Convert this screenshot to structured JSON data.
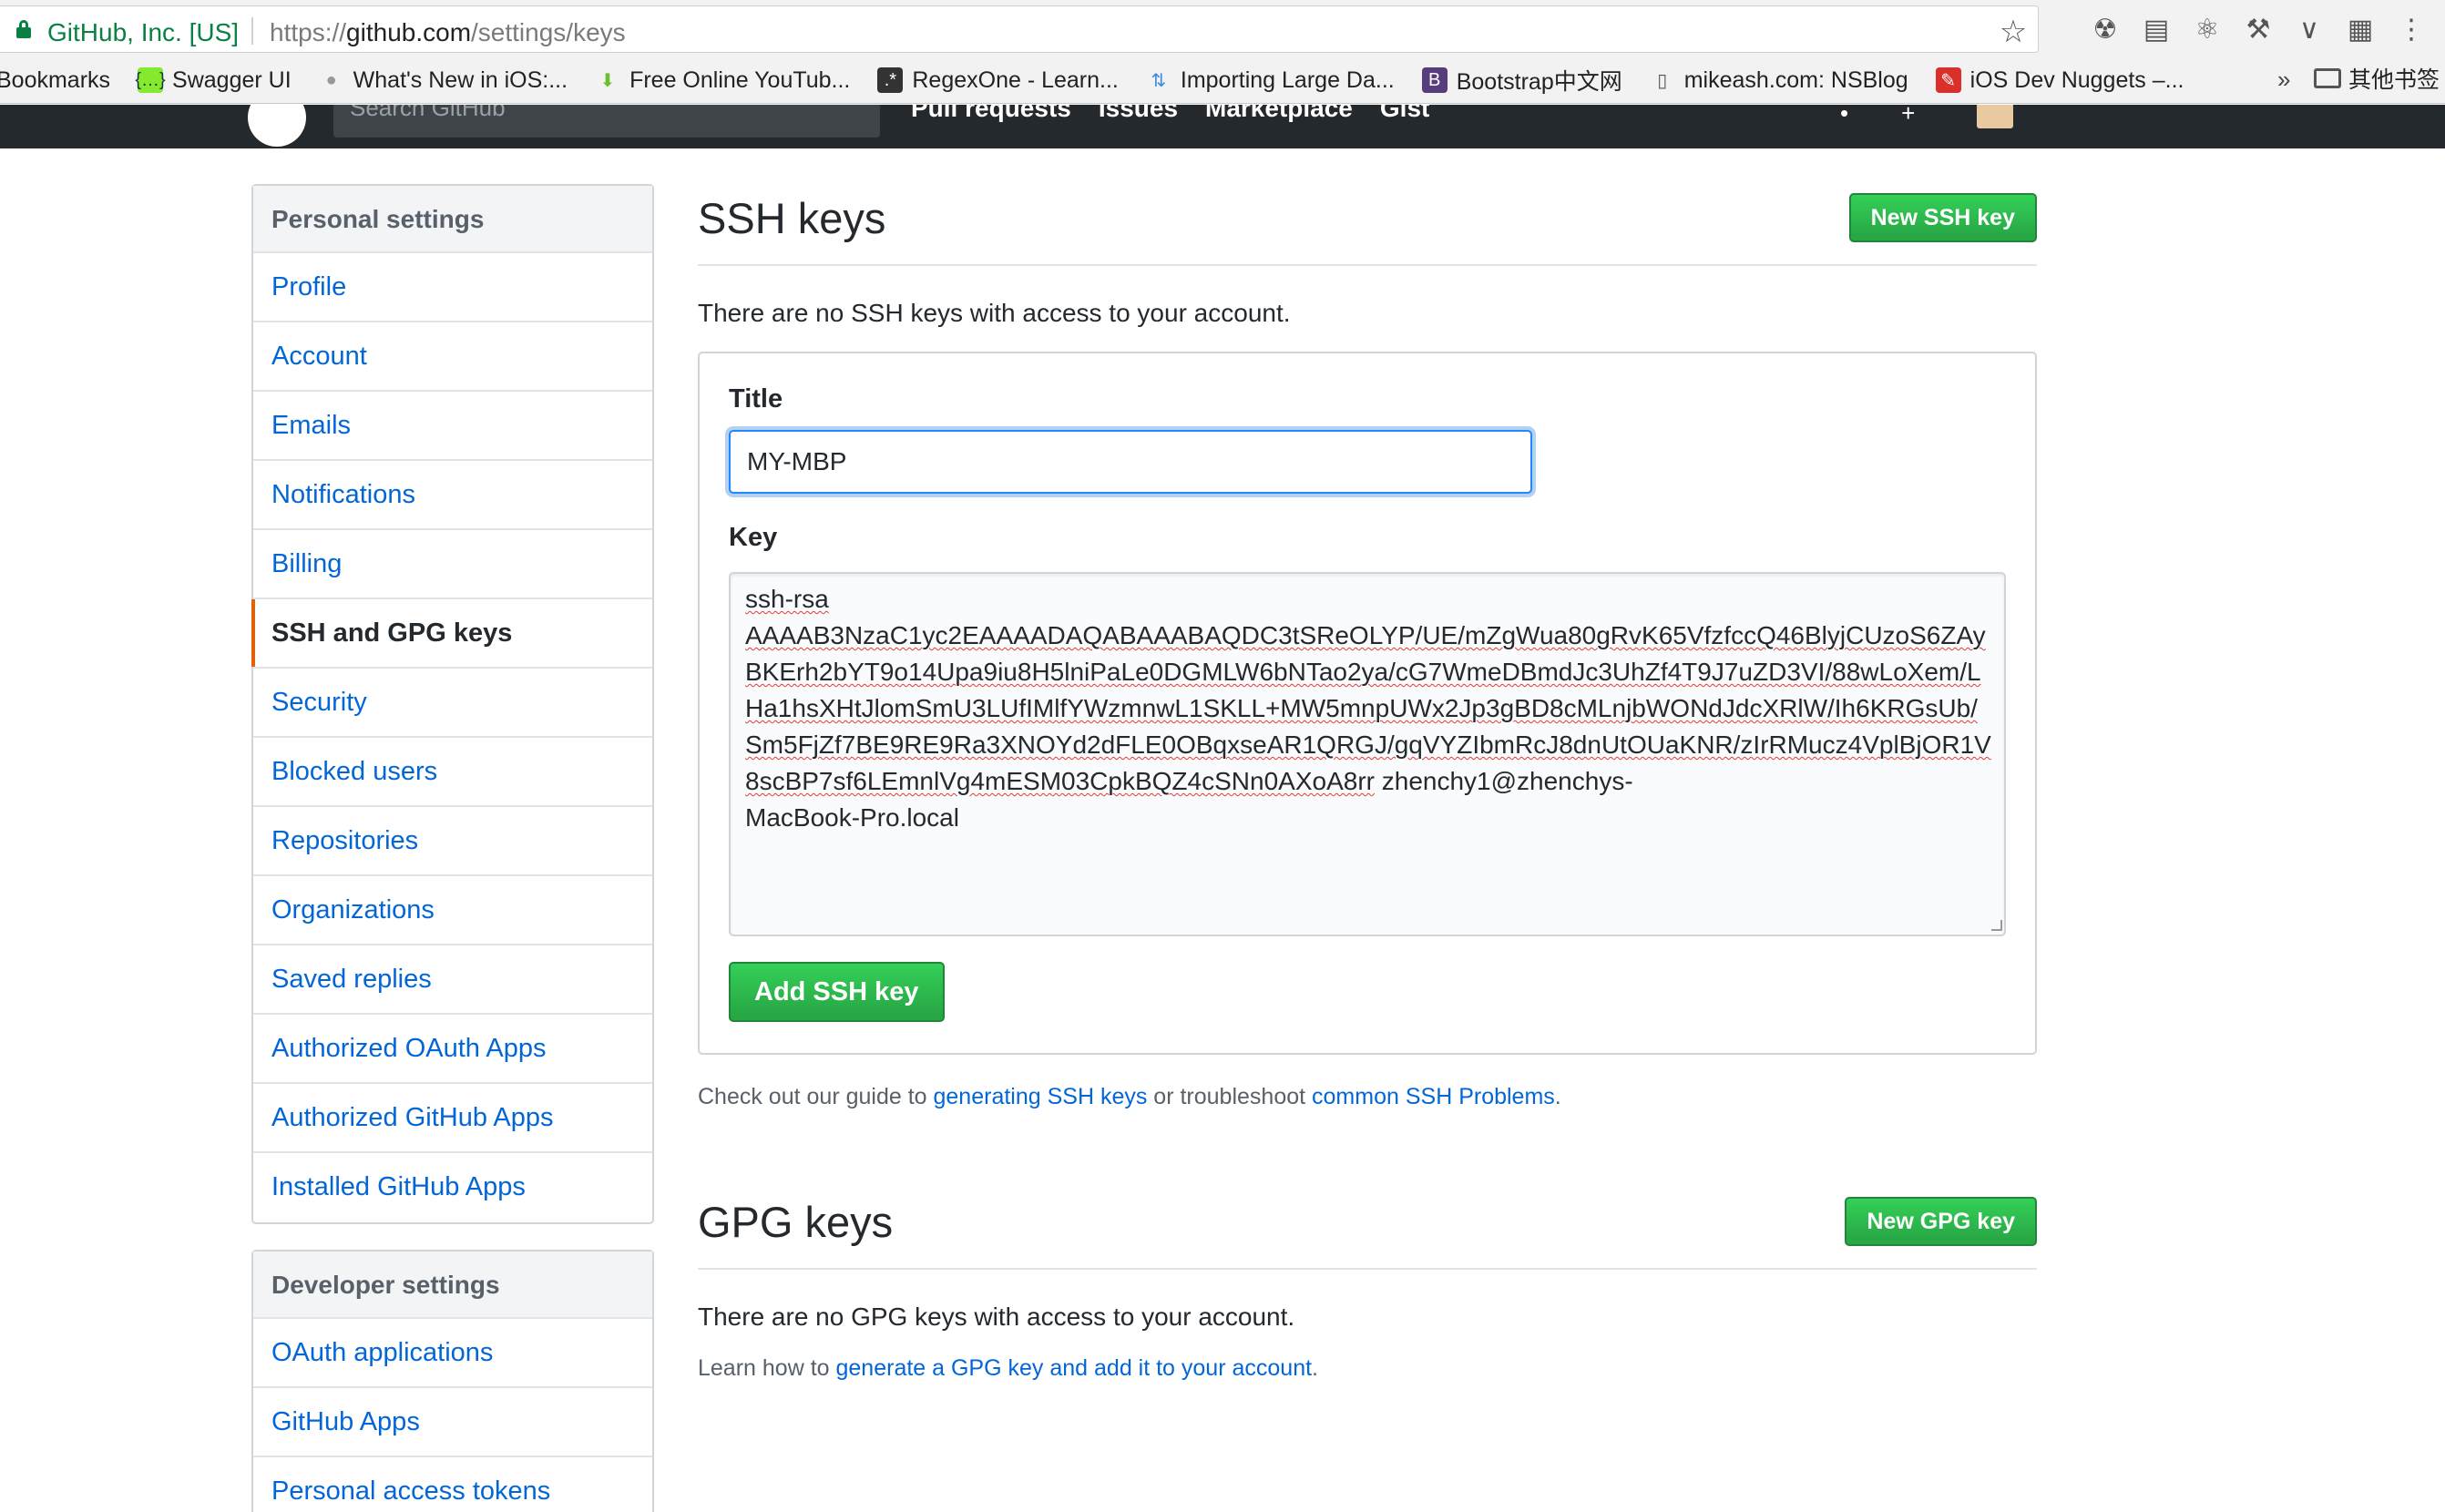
{
  "browser": {
    "site_identity": "GitHub, Inc. [US]",
    "url_protocol": "https://",
    "url_host": "github.com",
    "url_path": "/settings/keys",
    "bookmarks": [
      {
        "label": "Bookmarks",
        "icon": "none"
      },
      {
        "label": "Swagger UI",
        "icon": "swagger-icon"
      },
      {
        "label": "What's New in iOS:...",
        "icon": "apple-icon"
      },
      {
        "label": "Free Online YouTub...",
        "icon": "download-arrow-icon"
      },
      {
        "label": "RegexOne - Learn...",
        "icon": "regex-icon"
      },
      {
        "label": "Importing Large Da...",
        "icon": "sort-arrows-icon"
      },
      {
        "label": "Bootstrap中文网",
        "icon": "bootstrap-icon"
      },
      {
        "label": "mikeash.com: NSBlog",
        "icon": "page-icon"
      },
      {
        "label": "iOS Dev Nuggets –...",
        "icon": "nuggets-icon"
      }
    ],
    "bookmarks_overflow": "»",
    "other_bookmarks": "其他书签"
  },
  "github_header": {
    "search_placeholder": "Search GitHub",
    "nav": [
      "Pull requests",
      "Issues",
      "Marketplace",
      "Gist"
    ]
  },
  "sidebar": {
    "personal_heading": "Personal settings",
    "personal_items": [
      {
        "label": "Profile",
        "selected": false
      },
      {
        "label": "Account",
        "selected": false
      },
      {
        "label": "Emails",
        "selected": false
      },
      {
        "label": "Notifications",
        "selected": false
      },
      {
        "label": "Billing",
        "selected": false
      },
      {
        "label": "SSH and GPG keys",
        "selected": true
      },
      {
        "label": "Security",
        "selected": false
      },
      {
        "label": "Blocked users",
        "selected": false
      },
      {
        "label": "Repositories",
        "selected": false
      },
      {
        "label": "Organizations",
        "selected": false
      },
      {
        "label": "Saved replies",
        "selected": false
      },
      {
        "label": "Authorized OAuth Apps",
        "selected": false
      },
      {
        "label": "Authorized GitHub Apps",
        "selected": false
      },
      {
        "label": "Installed GitHub Apps",
        "selected": false
      }
    ],
    "developer_heading": "Developer settings",
    "developer_items": [
      {
        "label": "OAuth applications"
      },
      {
        "label": "GitHub Apps"
      },
      {
        "label": "Personal access tokens"
      }
    ]
  },
  "ssh": {
    "title": "SSH keys",
    "new_button": "New SSH key",
    "empty_text": "There are no SSH keys with access to your account.",
    "form": {
      "title_label": "Title",
      "title_value": "MY-MBP",
      "key_label": "Key",
      "key_prefix": "ssh-rsa",
      "key_body": "AAAAB3NzaC1yc2EAAAADAQABAAABAQDC3tSReOLYP/UE/mZgWua80gRvK65VfzfccQ46BlyjCUzoS6ZAyBKErh2bYT9o14Upa9iu8H5lniPaLe0DGMLW6bNTao2ya/cG7WmeDBmdJc3UhZf4T9J7uZD3VI/88wLoXem/LHa1hsXHtJlomSmU3LUfIMlfYWzmnwL1SKLL+MW5mnpUWx2Jp3gBD8cMLnjbWONdJdcXRlW/Ih6KRGsUb/Sm5FjZf7BE9RE9Ra3XNOYd2dFLE0OBqxseAR1QRGJ/gqVYZIbmRcJ8dnUtOUaKNR/zIrRMucz4VplBjOR1V8scBP7sf6LEmnlVg4mESM03CpkBQZ4cSNn0AXoA8rr",
      "key_comment_1": "zhenchy1@zhenchys-",
      "key_comment_2": "MacBook-Pro.local",
      "submit_button": "Add SSH key"
    },
    "help_prefix": "Check out our guide to ",
    "help_link_1": "generating SSH keys",
    "help_middle": " or troubleshoot ",
    "help_link_2": "common SSH Problems",
    "help_suffix": "."
  },
  "gpg": {
    "title": "GPG keys",
    "new_button": "New GPG key",
    "empty_text": "There are no GPG keys with access to your account.",
    "help_prefix": "Learn how to ",
    "help_link": "generate a GPG key and add it to your account",
    "help_suffix": "."
  },
  "colors": {
    "link": "#0366d6",
    "primary_button": "#28a745",
    "selected_marker": "#e36209",
    "secure_green": "#0b8043",
    "header_dark": "#24292e"
  }
}
